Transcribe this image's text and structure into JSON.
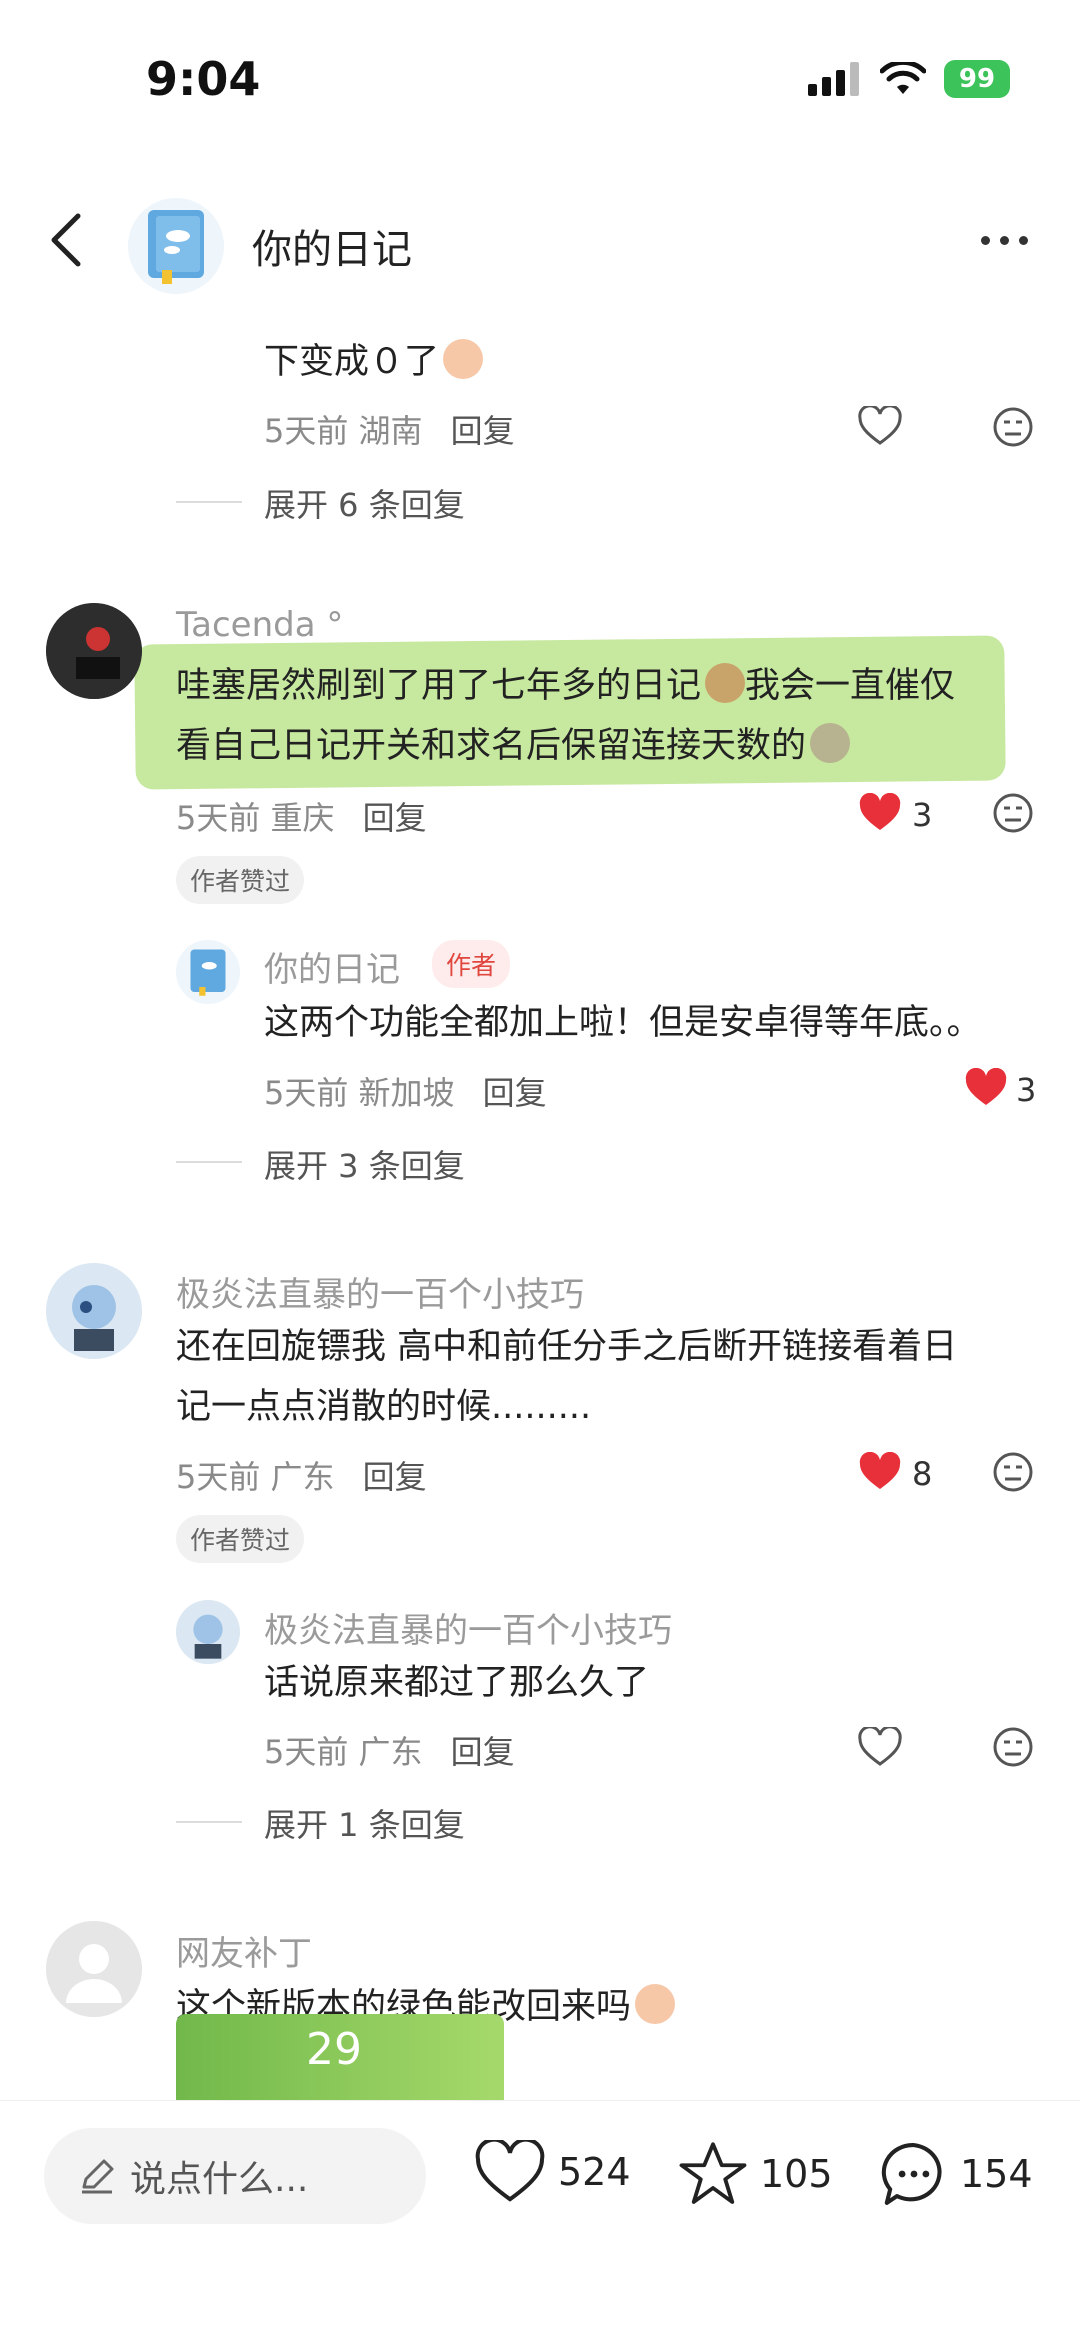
{
  "status": {
    "time": "9:04",
    "battery": "99"
  },
  "header": {
    "title": "你的日记"
  },
  "thread_top": {
    "text_tail": "下变成０了",
    "meta_time": "5天前",
    "meta_loc": "湖南",
    "reply": "回复",
    "expand": "展开 6 条回复"
  },
  "c1": {
    "name": "Tacenda",
    "name_suffix": "°",
    "line1": "哇塞居然刷到了用了七年多的日记",
    "line1b": "我会一直催仅",
    "line2": "看自己日记开关和求名后保留连接天数的",
    "meta_time": "5天前",
    "meta_loc": "重庆",
    "reply": "回复",
    "likes": "3",
    "author_liked": "作者赞过",
    "sub": {
      "name": "你的日记",
      "tag": "作者",
      "text": "这两个功能全都加上啦！但是安卓得等年底。。",
      "meta_time": "5天前",
      "meta_loc": "新加坡",
      "reply": "回复",
      "likes": "3"
    },
    "expand": "展开 3 条回复"
  },
  "c2": {
    "name": "极炎法直暴的一百个小技巧",
    "line1": "还在回旋镖我 高中和前任分手之后断开链接看着日",
    "line2": "记一点点消散的时候.........",
    "meta_time": "5天前",
    "meta_loc": "广东",
    "reply": "回复",
    "likes": "8",
    "author_liked": "作者赞过",
    "sub": {
      "name": "极炎法直暴的一百个小技巧",
      "text": "话说原来都过了那么久了",
      "meta_time": "5天前",
      "meta_loc": "广东",
      "reply": "回复"
    },
    "expand": "展开 1 条回复"
  },
  "c3": {
    "name": "网友补丁",
    "text": "这个新版本的绿色能改回来吗",
    "preview_number": "29"
  },
  "bottom": {
    "say_placeholder": "说点什么...",
    "likes": "524",
    "favorites": "105",
    "comments": "154"
  },
  "colors": {
    "accent_green": "#3cc35a",
    "heart_red": "#e8303a",
    "highlight": "#a9dc6b"
  }
}
